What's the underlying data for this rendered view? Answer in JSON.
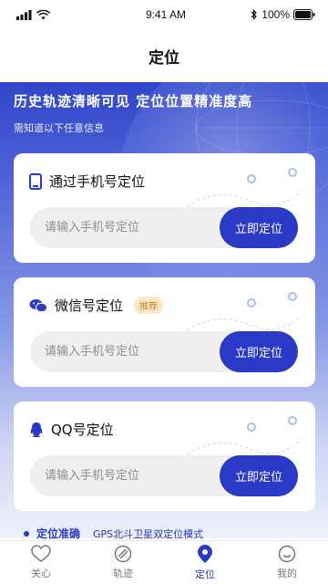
{
  "status": {
    "time": "9:41 AM",
    "battery": "100%"
  },
  "nav": {
    "title": "定位"
  },
  "hero": {
    "title": "历史轨迹清晰可见 定位位置精准度高",
    "subtitle": "需知道以下任意信息"
  },
  "cards": [
    {
      "title": "通过手机号定位",
      "badge": "",
      "placeholder": "请输入手机号定位",
      "button": "立即定位",
      "icon": "phone-icon"
    },
    {
      "title": "微信号定位",
      "badge": "推荐",
      "placeholder": "请输入手机号定位",
      "button": "立即定位",
      "icon": "wechat-icon"
    },
    {
      "title": "QQ号定位",
      "badge": "",
      "placeholder": "请输入手机号定位",
      "button": "立即定位",
      "icon": "qq-icon"
    }
  ],
  "feature": {
    "title": "定位准确",
    "desc": "GPS北斗卫星双定位模式"
  },
  "tabs": [
    {
      "label": "关心",
      "icon": "heart-icon",
      "active": false
    },
    {
      "label": "轨迹",
      "icon": "track-icon",
      "active": false
    },
    {
      "label": "定位",
      "icon": "location-pin-icon",
      "active": true
    },
    {
      "label": "我的",
      "icon": "smile-icon",
      "active": false
    }
  ],
  "colors": {
    "primary": "#2a39c6",
    "badge_bg": "#fbe9c9",
    "badge_text": "#c8862b"
  }
}
